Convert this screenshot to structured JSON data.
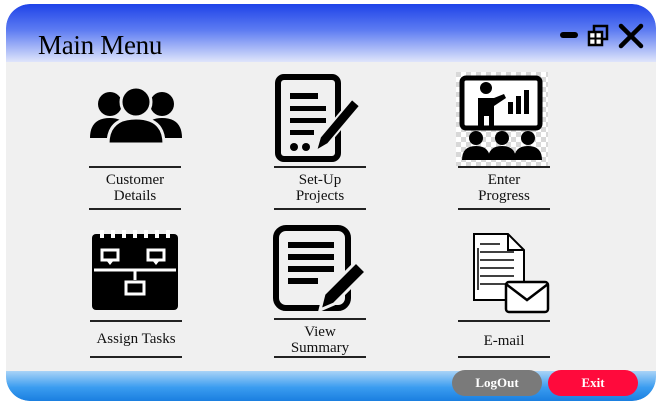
{
  "window": {
    "title": "Main Menu"
  },
  "controls": {
    "minimize_icon": "minimize-icon",
    "restore_icon": "restore-icon",
    "close_icon": "close-icon"
  },
  "menu": {
    "customer_details": {
      "line1": "Customer",
      "line2": "Details",
      "icon": "users-group-icon"
    },
    "setup_projects": {
      "line1": "Set-Up",
      "line2": "Projects",
      "icon": "document-signature-icon"
    },
    "enter_progress": {
      "line1": "Enter",
      "line2": "Progress",
      "icon": "presentation-icon"
    },
    "assign_tasks": {
      "label": "Assign Tasks",
      "icon": "calendar-flowchart-icon"
    },
    "view_summary": {
      "line1": "View",
      "line2": "Summary",
      "icon": "edit-document-icon"
    },
    "email": {
      "label": "E-mail",
      "icon": "email-document-icon"
    }
  },
  "footer": {
    "logout_label": "LogOut",
    "exit_label": "Exit"
  },
  "colors": {
    "title_bar": "#1f43e8",
    "footer_bar": "#3a9cf0",
    "logout_button": "#7a7a7a",
    "exit_button": "#ff0a3c"
  }
}
